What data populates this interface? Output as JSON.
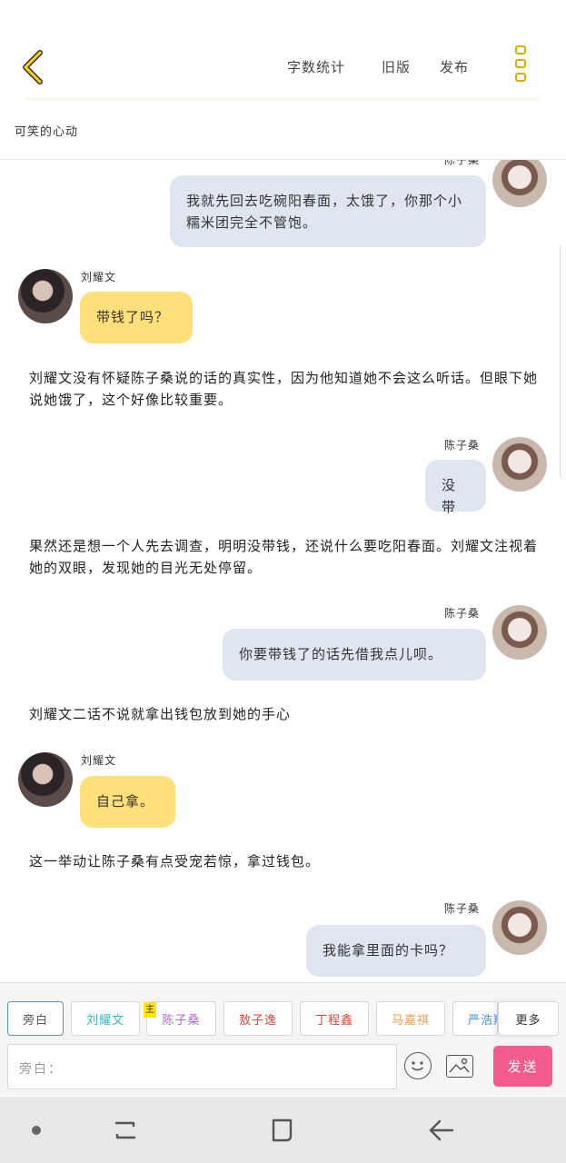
{
  "header": {
    "actions": [
      "字数统计",
      "旧版",
      "发布"
    ],
    "story_title": "可笑的心动"
  },
  "messages": [
    {
      "type": "right",
      "speaker": "陈子桑",
      "text": "我就先回去吃碗阳春面，太饿了，你那个小糯米团完全不管饱。"
    },
    {
      "type": "left",
      "speaker": "刘耀文",
      "text": "带钱了吗？"
    },
    {
      "type": "narration",
      "text": "刘耀文没有怀疑陈子桑说的话的真实性，因为他知道她不会这么听话。但眼下她说她饿了，这个好像比较重要。"
    },
    {
      "type": "right",
      "speaker": "陈子桑",
      "text": "没带"
    },
    {
      "type": "narration",
      "text": "果然还是想一个人先去调查，明明没带钱，还说什么要吃阳春面。刘耀文注视着她的双眼，发现她的目光无处停留。"
    },
    {
      "type": "right",
      "speaker": "陈子桑",
      "text": "你要带钱了的话先借我点儿呗。"
    },
    {
      "type": "narration",
      "text": "刘耀文二话不说就拿出钱包放到她的手心"
    },
    {
      "type": "left",
      "speaker": "刘耀文",
      "text": "自己拿。"
    },
    {
      "type": "narration",
      "text": "这一举动让陈子桑有点受宠若惊，拿过钱包。"
    },
    {
      "type": "right",
      "speaker": "陈子桑",
      "text": "我能拿里面的卡吗？"
    }
  ],
  "roles": [
    {
      "label": "旁白",
      "color": "#555555"
    },
    {
      "label": "刘耀文",
      "color": "#3bb3b8"
    },
    {
      "label": "陈子桑",
      "color": "#b06ad0"
    },
    {
      "label": "敖子逸",
      "color": "#e0443a"
    },
    {
      "label": "丁程鑫",
      "color": "#e0443a"
    },
    {
      "label": "马嘉祺",
      "color": "#f29e4c"
    },
    {
      "label": "严浩翔",
      "color": "#4a90e2"
    }
  ],
  "role_tag": "主",
  "more_roles": "更多",
  "composer": {
    "placeholder": "旁白：",
    "send_label": "发送"
  },
  "colors": {
    "accent": "#ffe07a",
    "send": "#f35a8e",
    "bubble_blue": "#dfe6ef"
  }
}
